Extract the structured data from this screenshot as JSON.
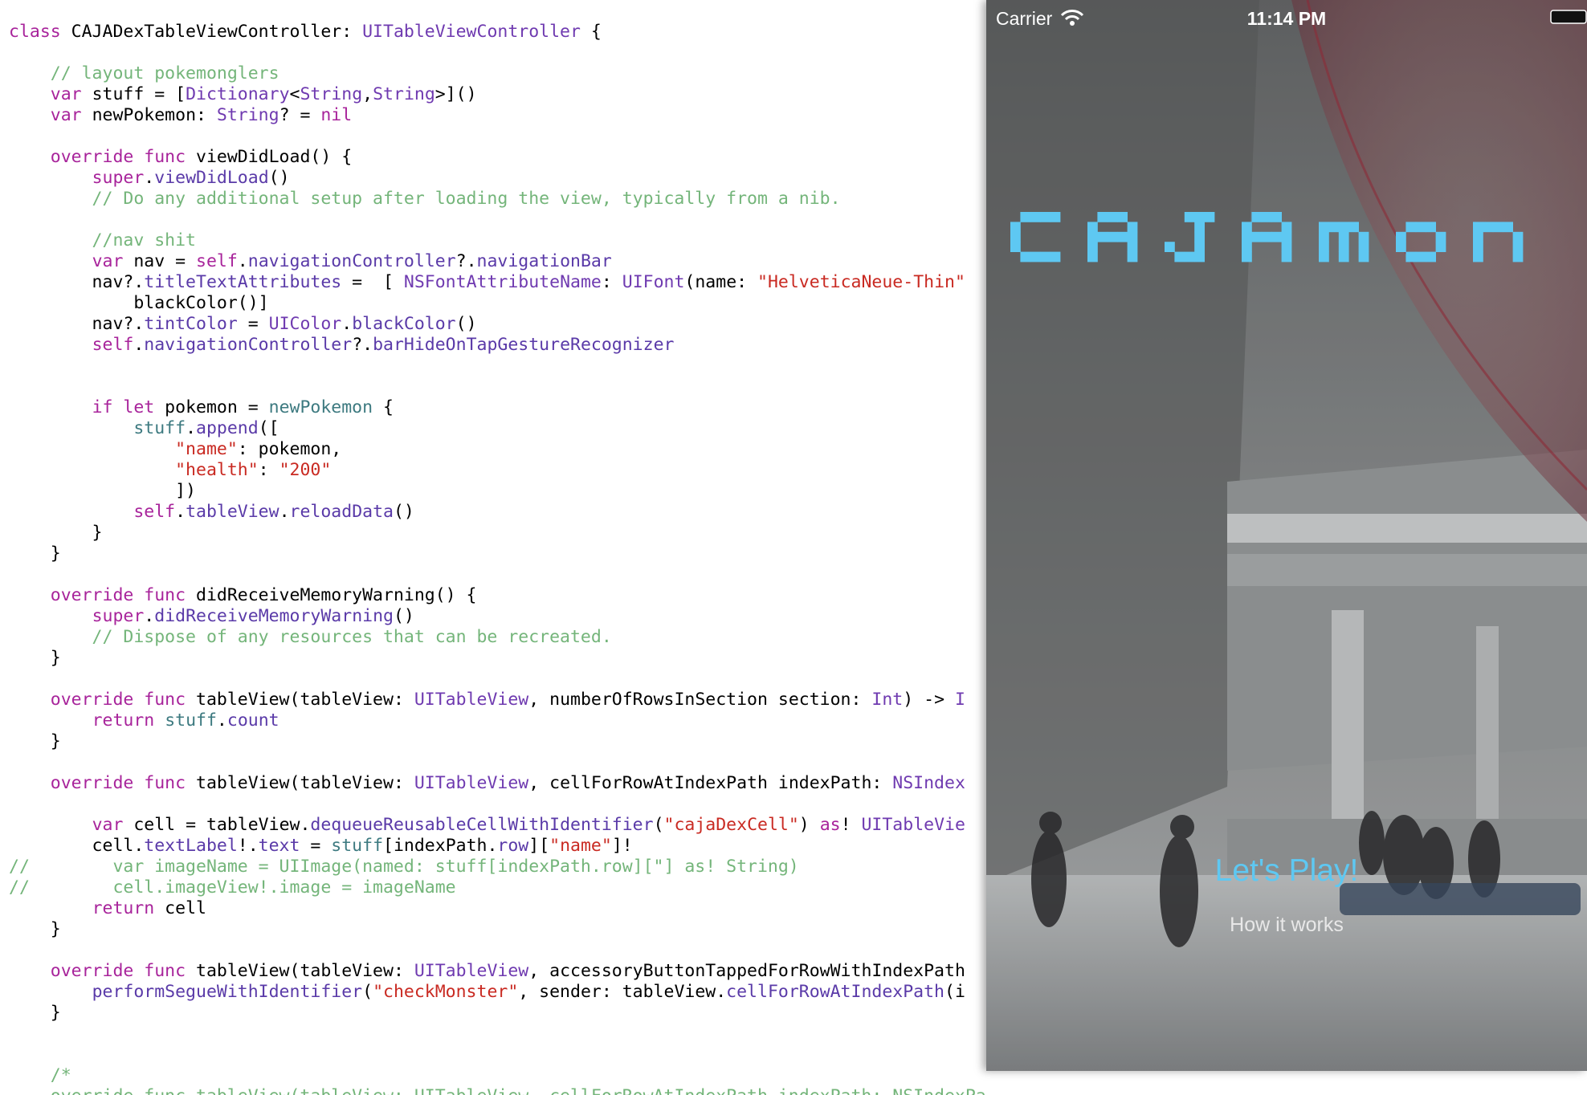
{
  "code": {
    "lines": [
      [
        {
          "t": "class ",
          "c": "kw"
        },
        {
          "t": "CAJADexTableViewController: "
        },
        {
          "t": "UITableViewController",
          "c": "ty"
        },
        {
          "t": " {"
        }
      ],
      [],
      [
        {
          "t": "    // layout pokemonglers",
          "c": "cm"
        }
      ],
      [
        {
          "t": "    "
        },
        {
          "t": "var",
          "c": "kw"
        },
        {
          "t": " stuff = ["
        },
        {
          "t": "Dictionary",
          "c": "ty"
        },
        {
          "t": "<"
        },
        {
          "t": "String",
          "c": "ty"
        },
        {
          "t": ","
        },
        {
          "t": "String",
          "c": "ty"
        },
        {
          "t": ">]()"
        }
      ],
      [
        {
          "t": "    "
        },
        {
          "t": "var",
          "c": "kw"
        },
        {
          "t": " newPokemon: "
        },
        {
          "t": "String",
          "c": "ty"
        },
        {
          "t": "? = "
        },
        {
          "t": "nil",
          "c": "kw"
        }
      ],
      [],
      [
        {
          "t": "    "
        },
        {
          "t": "override func",
          "c": "kw"
        },
        {
          "t": " viewDidLoad() {"
        }
      ],
      [
        {
          "t": "        "
        },
        {
          "t": "super",
          "c": "kw"
        },
        {
          "t": "."
        },
        {
          "t": "viewDidLoad",
          "c": "pr"
        },
        {
          "t": "()"
        }
      ],
      [
        {
          "t": "        // Do any additional setup after loading the view, typically from a nib.",
          "c": "cm"
        }
      ],
      [],
      [
        {
          "t": "        //nav shit",
          "c": "cm"
        }
      ],
      [
        {
          "t": "        "
        },
        {
          "t": "var",
          "c": "kw"
        },
        {
          "t": " nav = "
        },
        {
          "t": "self",
          "c": "kw"
        },
        {
          "t": "."
        },
        {
          "t": "navigationController",
          "c": "pr"
        },
        {
          "t": "?."
        },
        {
          "t": "navigationBar",
          "c": "pr"
        }
      ],
      [
        {
          "t": "        nav?."
        },
        {
          "t": "titleTextAttributes",
          "c": "pr"
        },
        {
          "t": " =  [ "
        },
        {
          "t": "NSFontAttributeName",
          "c": "ty"
        },
        {
          "t": ": "
        },
        {
          "t": "UIFont",
          "c": "ty"
        },
        {
          "t": "(name: "
        },
        {
          "t": "\"HelveticaNeue-Thin\"",
          "c": "st"
        }
      ],
      [
        {
          "t": "            blackColor()]"
        }
      ],
      [
        {
          "t": "        nav?."
        },
        {
          "t": "tintColor",
          "c": "pr"
        },
        {
          "t": " = "
        },
        {
          "t": "UIColor",
          "c": "ty"
        },
        {
          "t": "."
        },
        {
          "t": "blackColor",
          "c": "pr"
        },
        {
          "t": "()"
        }
      ],
      [
        {
          "t": "        "
        },
        {
          "t": "self",
          "c": "kw"
        },
        {
          "t": "."
        },
        {
          "t": "navigationController",
          "c": "pr"
        },
        {
          "t": "?."
        },
        {
          "t": "barHideOnTapGestureRecognizer",
          "c": "pr"
        }
      ],
      [],
      [],
      [
        {
          "t": "        "
        },
        {
          "t": "if let",
          "c": "kw"
        },
        {
          "t": " pokemon = "
        },
        {
          "t": "newPokemon",
          "c": "vr"
        },
        {
          "t": " {"
        }
      ],
      [
        {
          "t": "            "
        },
        {
          "t": "stuff",
          "c": "vr"
        },
        {
          "t": "."
        },
        {
          "t": "append",
          "c": "pr"
        },
        {
          "t": "(["
        }
      ],
      [
        {
          "t": "                "
        },
        {
          "t": "\"name\"",
          "c": "st"
        },
        {
          "t": ": pokemon,"
        }
      ],
      [
        {
          "t": "                "
        },
        {
          "t": "\"health\"",
          "c": "st"
        },
        {
          "t": ": "
        },
        {
          "t": "\"200\"",
          "c": "st"
        }
      ],
      [
        {
          "t": "                ])"
        }
      ],
      [
        {
          "t": "            "
        },
        {
          "t": "self",
          "c": "kw"
        },
        {
          "t": "."
        },
        {
          "t": "tableView",
          "c": "pr"
        },
        {
          "t": "."
        },
        {
          "t": "reloadData",
          "c": "pr"
        },
        {
          "t": "()"
        }
      ],
      [
        {
          "t": "        }"
        }
      ],
      [
        {
          "t": "    }"
        }
      ],
      [],
      [
        {
          "t": "    "
        },
        {
          "t": "override func",
          "c": "kw"
        },
        {
          "t": " didReceiveMemoryWarning() {"
        }
      ],
      [
        {
          "t": "        "
        },
        {
          "t": "super",
          "c": "kw"
        },
        {
          "t": "."
        },
        {
          "t": "didReceiveMemoryWarning",
          "c": "pr"
        },
        {
          "t": "()"
        }
      ],
      [
        {
          "t": "        // Dispose of any resources that can be recreated.",
          "c": "cm"
        }
      ],
      [
        {
          "t": "    }"
        }
      ],
      [],
      [
        {
          "t": "    "
        },
        {
          "t": "override func",
          "c": "kw"
        },
        {
          "t": " tableView(tableView: "
        },
        {
          "t": "UITableView",
          "c": "ty"
        },
        {
          "t": ", numberOfRowsInSection section: "
        },
        {
          "t": "Int",
          "c": "ty"
        },
        {
          "t": ") -> "
        },
        {
          "t": "I",
          "c": "ty"
        }
      ],
      [
        {
          "t": "        "
        },
        {
          "t": "return",
          "c": "kw"
        },
        {
          "t": " "
        },
        {
          "t": "stuff",
          "c": "vr"
        },
        {
          "t": "."
        },
        {
          "t": "count",
          "c": "pr"
        }
      ],
      [
        {
          "t": "    }"
        }
      ],
      [],
      [
        {
          "t": "    "
        },
        {
          "t": "override func",
          "c": "kw"
        },
        {
          "t": " tableView(tableView: "
        },
        {
          "t": "UITableView",
          "c": "ty"
        },
        {
          "t": ", cellForRowAtIndexPath indexPath: "
        },
        {
          "t": "NSIndex",
          "c": "ty"
        }
      ],
      [],
      [
        {
          "t": "        "
        },
        {
          "t": "var",
          "c": "kw"
        },
        {
          "t": " cell = tableView."
        },
        {
          "t": "dequeueReusableCellWithIdentifier",
          "c": "pr"
        },
        {
          "t": "("
        },
        {
          "t": "\"cajaDexCell\"",
          "c": "st"
        },
        {
          "t": ") "
        },
        {
          "t": "as",
          "c": "kw"
        },
        {
          "t": "! "
        },
        {
          "t": "UITableVie",
          "c": "ty"
        }
      ],
      [
        {
          "t": "        cell."
        },
        {
          "t": "textLabel",
          "c": "pr"
        },
        {
          "t": "!."
        },
        {
          "t": "text",
          "c": "pr"
        },
        {
          "t": " = "
        },
        {
          "t": "stuff",
          "c": "vr"
        },
        {
          "t": "[indexPath."
        },
        {
          "t": "row",
          "c": "pr"
        },
        {
          "t": "]["
        },
        {
          "t": "\"name\"",
          "c": "st"
        },
        {
          "t": "]!"
        }
      ],
      [
        {
          "t": "//        var imageName = UIImage(named: stuff[indexPath.row][\"] as! String)",
          "c": "cm"
        }
      ],
      [
        {
          "t": "//        cell.imageView!.image = imageName",
          "c": "cm"
        }
      ],
      [
        {
          "t": "        "
        },
        {
          "t": "return",
          "c": "kw"
        },
        {
          "t": " cell"
        }
      ],
      [
        {
          "t": "    }"
        }
      ],
      [],
      [
        {
          "t": "    "
        },
        {
          "t": "override func",
          "c": "kw"
        },
        {
          "t": " tableView(tableView: "
        },
        {
          "t": "UITableView",
          "c": "ty"
        },
        {
          "t": ", accessoryButtonTappedForRowWithIndexPath"
        }
      ],
      [
        {
          "t": "        "
        },
        {
          "t": "performSegueWithIdentifier",
          "c": "pr"
        },
        {
          "t": "("
        },
        {
          "t": "\"checkMonster\"",
          "c": "st"
        },
        {
          "t": ", sender: tableView."
        },
        {
          "t": "cellForRowAtIndexPath",
          "c": "pr"
        },
        {
          "t": "(i"
        }
      ],
      [
        {
          "t": "    }"
        }
      ],
      [],
      [],
      [
        {
          "t": "    /*",
          "c": "cm"
        }
      ],
      [
        {
          "t": "    override func tableView(tableView: UITableView, cellForRowAtIndexPath indexPath: NSIndexPath) -> UITableViewCell {",
          "c": "cm"
        }
      ]
    ]
  },
  "simulator": {
    "status_bar": {
      "carrier": "Carrier",
      "time": "11:14 PM"
    },
    "logo_text": "CAJAmon",
    "play_button": "Let's Play!",
    "how_button": "How it works",
    "colors": {
      "logo": "#5ec8f2",
      "play_button": "#5ec8f2",
      "how_button": "#e8e8e8"
    }
  }
}
